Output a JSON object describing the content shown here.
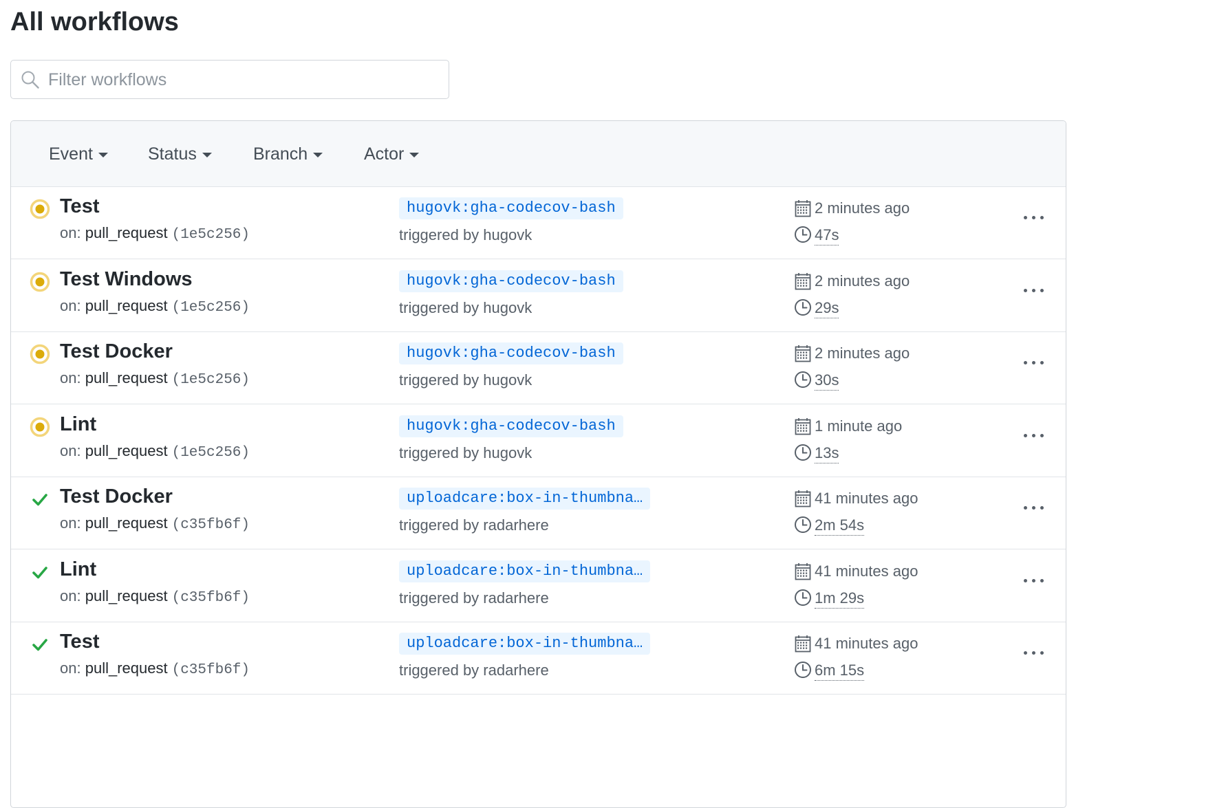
{
  "page_title": "All workflows",
  "search": {
    "placeholder": "Filter workflows",
    "value": ""
  },
  "filters": [
    {
      "label": "Event"
    },
    {
      "label": "Status"
    },
    {
      "label": "Branch"
    },
    {
      "label": "Actor"
    }
  ],
  "colors": {
    "in_progress": "#dbab09",
    "success": "#28a745",
    "branch_bg": "#eaf5ff",
    "branch_text": "#0366d6"
  },
  "runs": [
    {
      "status": "in_progress",
      "status_icon": "in-progress-dot-icon",
      "title": "Test",
      "on_label": "on:",
      "event": "pull_request",
      "sha": "(1e5c256)",
      "branch": "hugovk:gha-codecov-bash",
      "triggered_by": "triggered by hugovk",
      "created": "2 minutes ago",
      "duration": "47s"
    },
    {
      "status": "in_progress",
      "status_icon": "in-progress-dot-icon",
      "title": "Test Windows",
      "on_label": "on:",
      "event": "pull_request",
      "sha": "(1e5c256)",
      "branch": "hugovk:gha-codecov-bash",
      "triggered_by": "triggered by hugovk",
      "created": "2 minutes ago",
      "duration": "29s"
    },
    {
      "status": "in_progress",
      "status_icon": "in-progress-dot-icon",
      "title": "Test Docker",
      "on_label": "on:",
      "event": "pull_request",
      "sha": "(1e5c256)",
      "branch": "hugovk:gha-codecov-bash",
      "triggered_by": "triggered by hugovk",
      "created": "2 minutes ago",
      "duration": "30s"
    },
    {
      "status": "in_progress",
      "status_icon": "in-progress-dot-icon",
      "title": "Lint",
      "on_label": "on:",
      "event": "pull_request",
      "sha": "(1e5c256)",
      "branch": "hugovk:gha-codecov-bash",
      "triggered_by": "triggered by hugovk",
      "created": "1 minute ago",
      "duration": "13s"
    },
    {
      "status": "success",
      "status_icon": "check-icon",
      "title": "Test Docker",
      "on_label": "on:",
      "event": "pull_request",
      "sha": "(c35fb6f)",
      "branch": "uploadcare:box-in-thumbna…",
      "triggered_by": "triggered by radarhere",
      "created": "41 minutes ago",
      "duration": "2m 54s"
    },
    {
      "status": "success",
      "status_icon": "check-icon",
      "title": "Lint",
      "on_label": "on:",
      "event": "pull_request",
      "sha": "(c35fb6f)",
      "branch": "uploadcare:box-in-thumbna…",
      "triggered_by": "triggered by radarhere",
      "created": "41 minutes ago",
      "duration": "1m 29s"
    },
    {
      "status": "success",
      "status_icon": "check-icon",
      "title": "Test",
      "on_label": "on:",
      "event": "pull_request",
      "sha": "(c35fb6f)",
      "branch": "uploadcare:box-in-thumbna…",
      "triggered_by": "triggered by radarhere",
      "created": "41 minutes ago",
      "duration": "6m 15s"
    }
  ]
}
